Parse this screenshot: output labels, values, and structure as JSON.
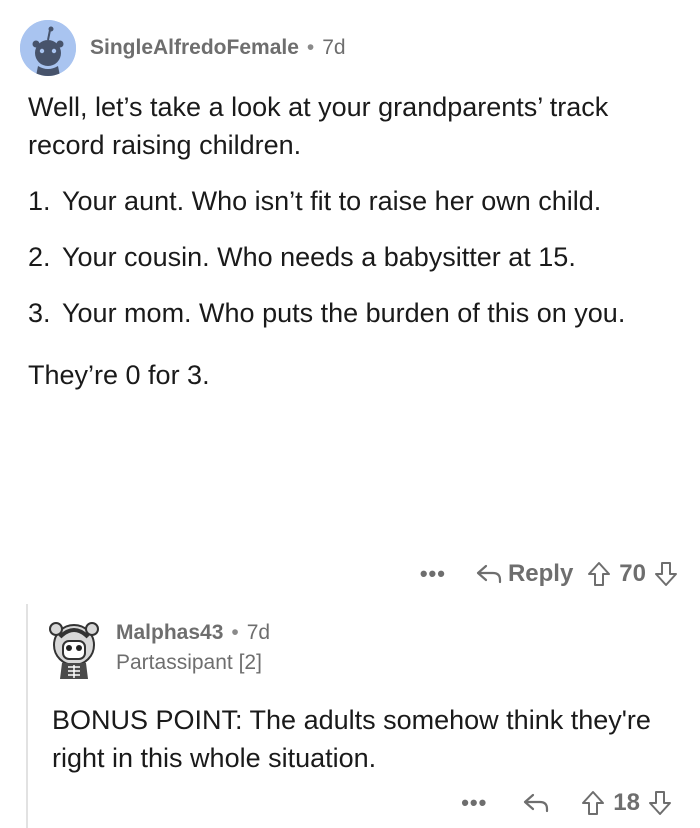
{
  "comment": {
    "username": "SingleAlfredoFemale",
    "separator": "•",
    "age": "7d",
    "intro": "Well, let’s take a look at your grandparents’ track record raising children.",
    "items": [
      {
        "num": "1.",
        "text": "Your aunt.  Who isn’t fit to raise her own child."
      },
      {
        "num": "2.",
        "text": "Your cousin.  Who needs a babysitter at 15."
      },
      {
        "num": "3.",
        "text": "Your mom.  Who puts the burden of this on you."
      }
    ],
    "closing": "They’re 0 for 3.",
    "actions": {
      "more": "•••",
      "reply_label": "Reply",
      "score": "70"
    }
  },
  "reply": {
    "username": "Malphas43",
    "separator": "•",
    "age": "7d",
    "flair": "Partassipant [2]",
    "body": "BONUS POINT: The adults somehow think they're right in this whole situation.",
    "actions": {
      "more": "•••",
      "score": "18"
    }
  },
  "icons": {
    "avatar": "reddit-snoo-avatar",
    "reply_avatar": "skeleton-snoo-avatar",
    "reply": "reply-arrow-icon",
    "upvote": "upvote-arrow-icon",
    "downvote": "downvote-arrow-icon",
    "more": "more-options-icon"
  },
  "colors": {
    "avatar_bg": "#a9c4f0",
    "muted_text": "#6e6e6e",
    "thread_line": "#e2e2e2"
  }
}
